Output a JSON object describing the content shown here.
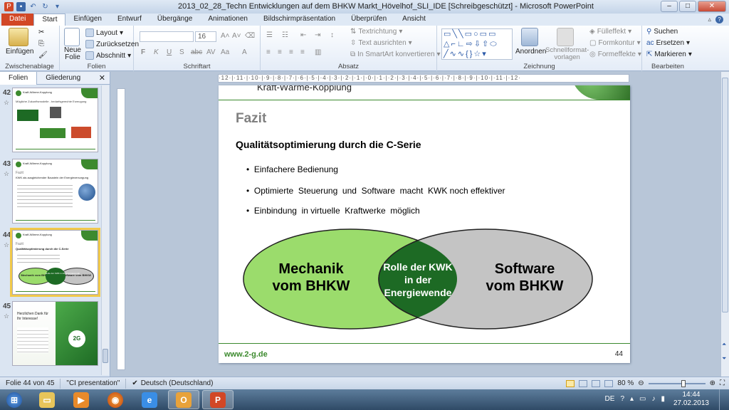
{
  "window": {
    "title": "2013_02_28_Techn  Entwicklungen auf dem BHKW Markt_Hövelhof_SLI_IDE [Schreibgeschützt]  -  Microsoft PowerPoint",
    "icon": "powerpoint-icon"
  },
  "ribbon_tabs": [
    "Datei",
    "Start",
    "Einfügen",
    "Entwurf",
    "Übergänge",
    "Animationen",
    "Bildschirmpräsentation",
    "Überprüfen",
    "Ansicht"
  ],
  "ribbon": {
    "clipboard": {
      "label": "Zwischenablage",
      "paste": "Einfügen"
    },
    "slides": {
      "label": "Folien",
      "new_slide": "Neue Folie",
      "layout": "Layout",
      "reset": "Zurücksetzen",
      "section": "Abschnitt"
    },
    "font": {
      "label": "Schriftart",
      "size": "16",
      "buttons": [
        "F",
        "K",
        "U",
        "S",
        "abc",
        "AV",
        "Aa",
        "A"
      ]
    },
    "paragraph": {
      "label": "Absatz",
      "text_direction": "Textrichtung",
      "align_text": "Text ausrichten",
      "smartart": "In SmartArt konvertieren"
    },
    "drawing": {
      "label": "Zeichnung",
      "arrange": "Anordnen",
      "quick_styles": "Schnellformat-vorlagen",
      "fill": "Fülleffekt",
      "outline": "Formkontur",
      "effects": "Formeffekte"
    },
    "editing": {
      "label": "Bearbeiten",
      "find": "Suchen",
      "replace": "Ersetzen",
      "select": "Markieren"
    }
  },
  "panel": {
    "tabs": [
      "Folien",
      "Gliederung"
    ],
    "thumbnails": [
      {
        "number": "42",
        "header": "Kraft-Wärme-Kopplung",
        "subtitle": "Mögliche Zukunftsmodelle - bedarfsgerechte Erzeugung"
      },
      {
        "number": "43",
        "header": "Kraft-Wärme-Kopplung",
        "subtitle": "Fazit",
        "line": "KWK als ausgleichender Baustein der Energieversorgung"
      },
      {
        "number": "44",
        "header": "Kraft-Wärme-Kopplung",
        "subtitle": "Fazit",
        "line": "Qualitätsoptimierung durch die C-Serie",
        "left": "Mechanik vom BHKW",
        "mid": "Rolle der KWK in der Energiewende",
        "right": "Software vom BHKW"
      },
      {
        "number": "45",
        "text": "Herzlichen Dank für Ihr Interesse!"
      }
    ]
  },
  "slide": {
    "header_partial": "Kraft-Wärme-Kopplung",
    "title": "Fazit",
    "subtitle": "Qualitätsoptimierung durch die C-Serie",
    "bullets": [
      "Einfachere Bedienung",
      "Optimierte  Steuerung  und  Software  macht  KWK noch effektiver",
      "Einbindung  in virtuelle  Kraftwerke  möglich"
    ],
    "left_label": "Mechanik\nvom BHKW",
    "center_label": "Rolle der KWK\nin der\nEnergiewende",
    "right_label": "Software\nvom BHKW",
    "footer_url": "www.2-g.de",
    "page_number": "44",
    "colors": {
      "green_light": "#9bdc6c",
      "green_dark": "#1d6a24",
      "grey": "#c4c4c4",
      "footer_green": "#3c8a2e"
    }
  },
  "status": {
    "slide_info": "Folie 44 von 45",
    "theme": "\"CI presentation\"",
    "language": "Deutsch (Deutschland)",
    "zoom": "80 %"
  },
  "taskbar": {
    "apps": [
      "windows-start",
      "explorer-icon",
      "media-player-icon",
      "firefox-icon",
      "ie-icon",
      "outlook-icon",
      "powerpoint-icon"
    ],
    "lang": "DE",
    "time": "14:44",
    "date": "27.02.2013"
  }
}
